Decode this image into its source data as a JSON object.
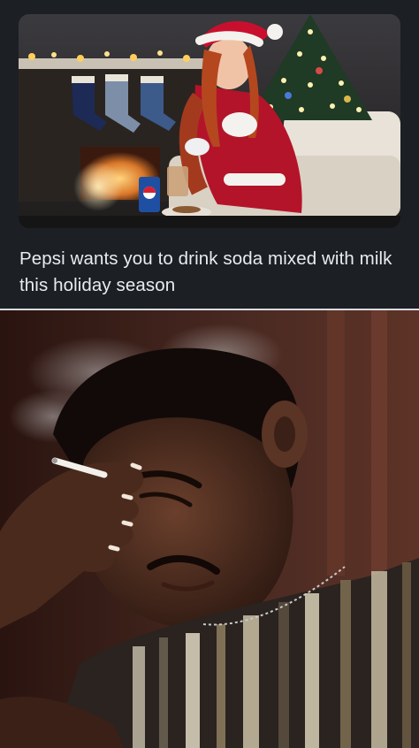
{
  "post": {
    "caption": "Pepsi wants you to drink soda mixed with milk this holiday season"
  },
  "images": {
    "top_photo": "woman-in-santa-outfit-pouring-milk-into-pepsi-icon",
    "bottom_photo": "man-smoking-facepalm-reaction-icon"
  },
  "colors": {
    "background": "#1c1f24",
    "caption_text": "#e9ecef",
    "santa_red": "#b3142a",
    "pepsi_blue": "#1f4fa3"
  }
}
